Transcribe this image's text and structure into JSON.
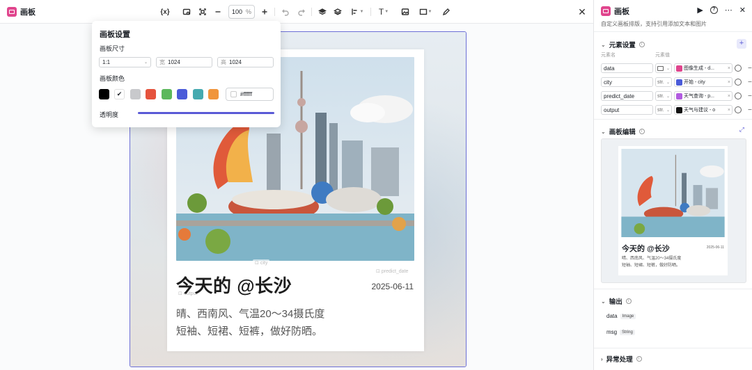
{
  "app": {
    "title": "画板"
  },
  "toolbar": {
    "variables_label": "{x}",
    "zoom_value": "100",
    "zoom_unit": "%",
    "text_tool": "T"
  },
  "popup": {
    "title": "画板设置",
    "size_label": "画板尺寸",
    "ratio": "1:1",
    "width_prefix": "宽",
    "width": "1024",
    "height_prefix": "高",
    "height": "1024",
    "color_label": "画板颜色",
    "swatches": [
      "#000000",
      "#ffffff",
      "#c8c9cc",
      "#e5533d",
      "#5cb85c",
      "#4a5bd9",
      "#45aab0",
      "#f0953c"
    ],
    "hex": "#ffffff",
    "opacity_label": "透明度",
    "accent": "#5a5ad6"
  },
  "card": {
    "title": "今天的 @长沙",
    "date": "2025-06-11",
    "line1": "晴、西南风、气温20～34摄氏度",
    "line2": "短袖、短裙、短裤，做好防晒。",
    "ghost_city": "city",
    "ghost_predict": "predict_date",
    "ghost_output": "output"
  },
  "panel": {
    "title": "画板",
    "desc": "自定义画板排版，支持引用添加文本和图片",
    "elements_header": "元素设置",
    "col_name": "元素名",
    "col_value": "元素值",
    "rows": [
      {
        "name": "data",
        "type": "",
        "value": "图像生成 - d...",
        "icon_color": "#e0458d"
      },
      {
        "name": "city",
        "type": "str.",
        "value": "开始 - city",
        "icon_color": "#4a5bd9"
      },
      {
        "name": "predict_date",
        "type": "str.",
        "value": "天气查询 - p...",
        "icon_color": "#b25be0"
      },
      {
        "name": "output",
        "type": "str.",
        "value": "天气与建议 - o",
        "icon_color": "#111111"
      }
    ],
    "editor_header": "画板编辑",
    "output_header": "输出",
    "outputs": [
      {
        "name": "data",
        "type": "Image"
      },
      {
        "name": "msg",
        "type": "String"
      }
    ],
    "error_header": "异常处理"
  }
}
